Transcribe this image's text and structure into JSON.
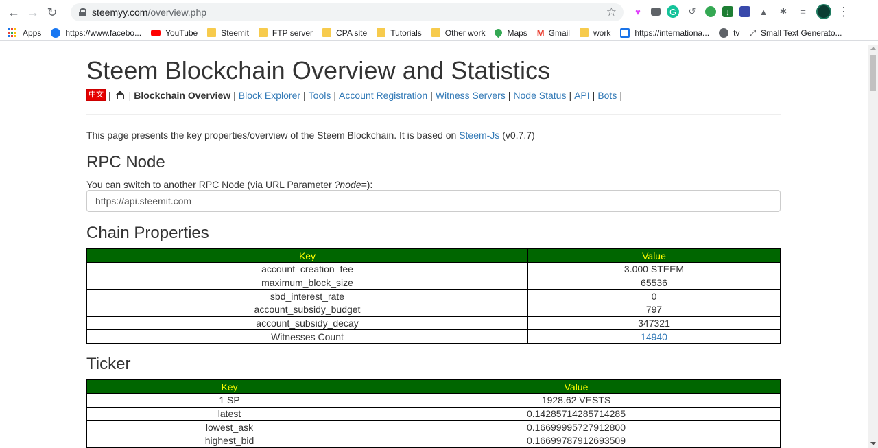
{
  "browser": {
    "url_domain": "steemyy.com",
    "url_path": "/overview.php",
    "bookmarks": [
      {
        "label": "Apps",
        "icon": "apps-grid-icon"
      },
      {
        "label": "https://www.facebo...",
        "icon": "facebook-icon"
      },
      {
        "label": "YouTube",
        "icon": "youtube-icon"
      },
      {
        "label": "Steemit",
        "icon": "folder-icon"
      },
      {
        "label": "FTP server",
        "icon": "folder-icon"
      },
      {
        "label": "CPA site",
        "icon": "folder-icon"
      },
      {
        "label": "Tutorials",
        "icon": "folder-icon"
      },
      {
        "label": "Other work",
        "icon": "folder-icon"
      },
      {
        "label": "Maps",
        "icon": "maps-icon"
      },
      {
        "label": "Gmail",
        "icon": "gmail-icon"
      },
      {
        "label": "work",
        "icon": "folder-icon"
      },
      {
        "label": "https://internationa...",
        "icon": "link-icon"
      },
      {
        "label": "tv",
        "icon": "globe-icon"
      },
      {
        "label": "Small Text Generato...",
        "icon": "arrows-icon"
      }
    ]
  },
  "page": {
    "title": "Steem Blockchain Overview and Statistics",
    "lang_badge": "中文",
    "nav": {
      "current": "Blockchain Overview",
      "links": [
        "Block Explorer",
        "Tools",
        "Account Registration",
        "Witness Servers",
        "Node Status",
        "API",
        "Bots"
      ]
    },
    "intro_text": "This page presents the key properties/overview of the Steem Blockchain. It is based on ",
    "intro_link": "Steem-Js",
    "intro_version": " (v0.7.7)",
    "rpc": {
      "heading": "RPC Node",
      "note_prefix": "You can switch to another RPC Node (via URL Parameter ",
      "note_param": "?node=",
      "note_suffix": "):",
      "value": "https://api.steemit.com"
    },
    "chain": {
      "heading": "Chain Properties",
      "col_key": "Key",
      "col_value": "Value",
      "rows": [
        {
          "key": "account_creation_fee",
          "value": "3.000 STEEM"
        },
        {
          "key": "maximum_block_size",
          "value": "65536"
        },
        {
          "key": "sbd_interest_rate",
          "value": "0"
        },
        {
          "key": "account_subsidy_budget",
          "value": "797"
        },
        {
          "key": "account_subsidy_decay",
          "value": "347321"
        },
        {
          "key": "Witnesses Count",
          "value": "14940",
          "link": true
        }
      ]
    },
    "ticker": {
      "heading": "Ticker",
      "col_key": "Key",
      "col_value": "Value",
      "rows": [
        {
          "key": "1 SP",
          "value": "1928.62 VESTS"
        },
        {
          "key": "latest",
          "value": "0.14285714285714285"
        },
        {
          "key": "lowest_ask",
          "value": "0.16699995727912800"
        },
        {
          "key": "highest_bid",
          "value": "0.16699787912693509"
        }
      ]
    }
  }
}
